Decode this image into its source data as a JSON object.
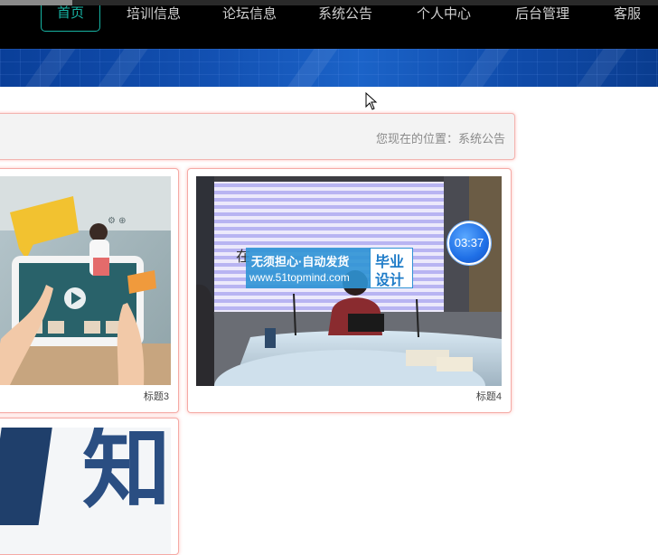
{
  "nav": {
    "items": [
      {
        "label": "首页",
        "active": true
      },
      {
        "label": "培训信息"
      },
      {
        "label": "论坛信息"
      },
      {
        "label": "系统公告"
      },
      {
        "label": "个人中心"
      },
      {
        "label": "后台管理"
      },
      {
        "label": "客服"
      }
    ]
  },
  "breadcrumb": {
    "text": "您现在的位置：系统公告"
  },
  "cards": [
    {
      "caption": "标题3"
    },
    {
      "caption": "标题4",
      "timer": "03:37",
      "ad": {
        "line1": "无须担心·自动发货",
        "line2": "www.51topmind.com",
        "badge1": "毕业",
        "badge2": "设计"
      },
      "partial_text": "在"
    },
    {
      "big_text": "知"
    }
  ],
  "colors": {
    "accent": "#17b3a3",
    "nav_bg": "#000000",
    "card_border": "#f5aaa5",
    "banner_blue": "#124fb0"
  }
}
